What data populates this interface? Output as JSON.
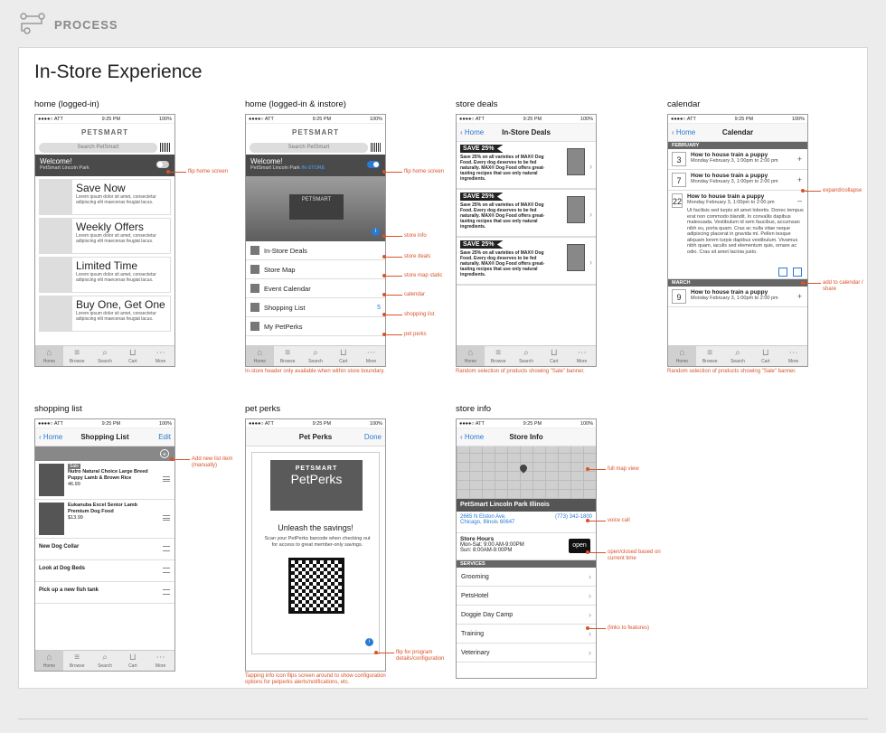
{
  "header": {
    "title": "PROCESS"
  },
  "page": {
    "title": "In-Store Experience"
  },
  "colors": {
    "accent": "#2a7ad2",
    "annotation": "#d9532a",
    "dark_bar": "#4a4a4a"
  },
  "status": {
    "carrier": "●●●●○ ATT",
    "time": "9:25 PM",
    "battery": "100%"
  },
  "tabs": [
    "Home",
    "Browse",
    "Search",
    "Cart",
    "More"
  ],
  "screens": {
    "home": {
      "label": "home (logged-in)",
      "search_placeholder": "Search PetSmart",
      "logo": "PETSMART",
      "welcome": "Welcome!",
      "store": "PetSmart Lincoln Park",
      "promos": [
        {
          "title": "Save Now",
          "body": "Lorem ipsum dolor sit amet, consectetur adipiscing elit maecenas feugiat lacus."
        },
        {
          "title": "Weekly Offers",
          "body": "Lorem ipsum dolor sit amet, consectetur adipiscing elit maecenas feugiat lacus."
        },
        {
          "title": "Limited Time",
          "body": "Lorem ipsum dolor sit amet, consectetur adipiscing elit maecenas feugiat lacus."
        },
        {
          "title": "Buy One, Get One",
          "body": "Lorem ipsum dolor sit amet, consectetur adipiscing elit maecenas feugiat lacus."
        }
      ],
      "annotation": "flip home screen"
    },
    "instore": {
      "label": "home (logged-in & instore)",
      "search_placeholder": "Search PetSmart",
      "logo": "PETSMART",
      "welcome": "Welcome!",
      "store": "PetSmart Lincoln Park",
      "instore_tag": "IN-STORE",
      "store_sign": "PETSMART",
      "menu": [
        {
          "label": "In-Store Deals",
          "count": ""
        },
        {
          "label": "Store Map",
          "count": ""
        },
        {
          "label": "Event Calendar",
          "count": ""
        },
        {
          "label": "Shopping List",
          "count": "5"
        },
        {
          "label": "My PetPerks",
          "count": ""
        }
      ],
      "annotations": [
        "flip home screen",
        "store info",
        "store deals",
        "store map static",
        "calendar",
        "shopping list",
        "pet perks"
      ],
      "caption": "In-store header only available when within store boundary."
    },
    "deals": {
      "label": "store deals",
      "back": "Home",
      "title": "In-Store Deals",
      "items": [
        {
          "banner": "SAVE 25%",
          "text": "Save 25% on all varieties of MAX® Dog Food. Every dog deserves to be fed naturally. MAX® Dog Food offers great-tasting recipes that use only natural ingredients."
        },
        {
          "banner": "SAVE 25%",
          "text": "Save 25% on all varieties of MAX® Dog Food. Every dog deserves to be fed naturally. MAX® Dog Food offers great-tasting recipes that use only natural ingredients."
        },
        {
          "banner": "SAVE 25%",
          "text": "Save 25% on all varieties of MAX® Dog Food. Every dog deserves to be fed naturally. MAX® Dog Food offers great-tasting recipes that use only natural ingredients."
        }
      ],
      "caption": "Random selection of products showing \"Sale\" banner."
    },
    "calendar": {
      "label": "calendar",
      "back": "Home",
      "title": "Calendar",
      "month1": "FEBRUARY",
      "month2": "MARCH",
      "events": [
        {
          "day": "3",
          "title": "How to house train a puppy",
          "when": "Monday February 3, 1:00pm to 2:00 pm",
          "sign": "+"
        },
        {
          "day": "7",
          "title": "How to house train a puppy",
          "when": "Monday February 3, 1:00pm to 2:00 pm",
          "sign": "+"
        },
        {
          "day": "22",
          "title": "How to house train a puppy",
          "when": "Monday February 3, 1:00pm to 2:00 pm",
          "sign": "–",
          "body": "Ut facilisis sed turpis sit amet lobortis. Donec tempus erat non commodo blandit. In convallis dapibus malesuada. Vestibulum id sem faucibus, accumsan nibh eu, porta quam. Cras ac nulla vitae neque adipiscing placerat in gravida mi. Pellen tesque aliquam lorem turpis dapibus vestibulum. Vivamus nibh quam, iaculis sed elementum quis, ornare ac odio. Cras sit amet lacinia justo."
        },
        {
          "day": "9",
          "title": "How to house train a puppy",
          "when": "Monday February 3, 1:00pm to 2:00 pm",
          "sign": "+"
        }
      ],
      "annotations": [
        "expand/collapse",
        "add to calendar / share"
      ],
      "caption": "Random selection of products showing \"Sale\" banner."
    },
    "list": {
      "label": "shopping list",
      "back": "Home",
      "title": "Shopping List",
      "edit": "Edit",
      "items": [
        {
          "badge": "Sale",
          "name": "Nutro Natural Choice Large Breed Puppy Lamb & Brown Rice",
          "price": "46.99"
        },
        {
          "badge": "",
          "name": "Eukanuba Excel Senior Lamb Premium Dog Food",
          "price": "$13.99"
        }
      ],
      "simple": [
        "New Dog Collar",
        "Look at Dog Beds",
        "Pick up a new fish tank"
      ],
      "annotation": "Add new list item (manually)"
    },
    "perks": {
      "label": "pet perks",
      "title": "Pet Perks",
      "done": "Done",
      "logo1": "PETSMART",
      "logo2": "PetPerks",
      "headline": "Unleash the savings!",
      "desc": "Scan your PetPerks barcode when checking out for access to great member-only savings.",
      "annotation": "flip for program details/configuration",
      "caption": "Tapping info icon flips screen around to show configuration options for petperks alerts/notifications, etc."
    },
    "storeinfo": {
      "label": "store info",
      "back": "Home",
      "title": "Store Info",
      "name": "PetSmart Lincoln Park Illinois",
      "addr1": "2665 N Elston Ave.",
      "addr2": "Chicago, Illinois 60647",
      "phone": "(773) 342-1800",
      "hours_title": "Store Hours",
      "hours1": "Mon-Sat: 9:00 AM-9:00PM",
      "hours2": "Sun: 8:00AM-9:00PM",
      "open": "open",
      "services_head": "SERVICES",
      "services": [
        "Grooming",
        "PetsHotel",
        "Doggie Day Camp",
        "Training",
        "Veterinary"
      ],
      "annotations": [
        "full map view",
        "voice call",
        "open/closed based on current time",
        "(links to features)"
      ]
    }
  }
}
